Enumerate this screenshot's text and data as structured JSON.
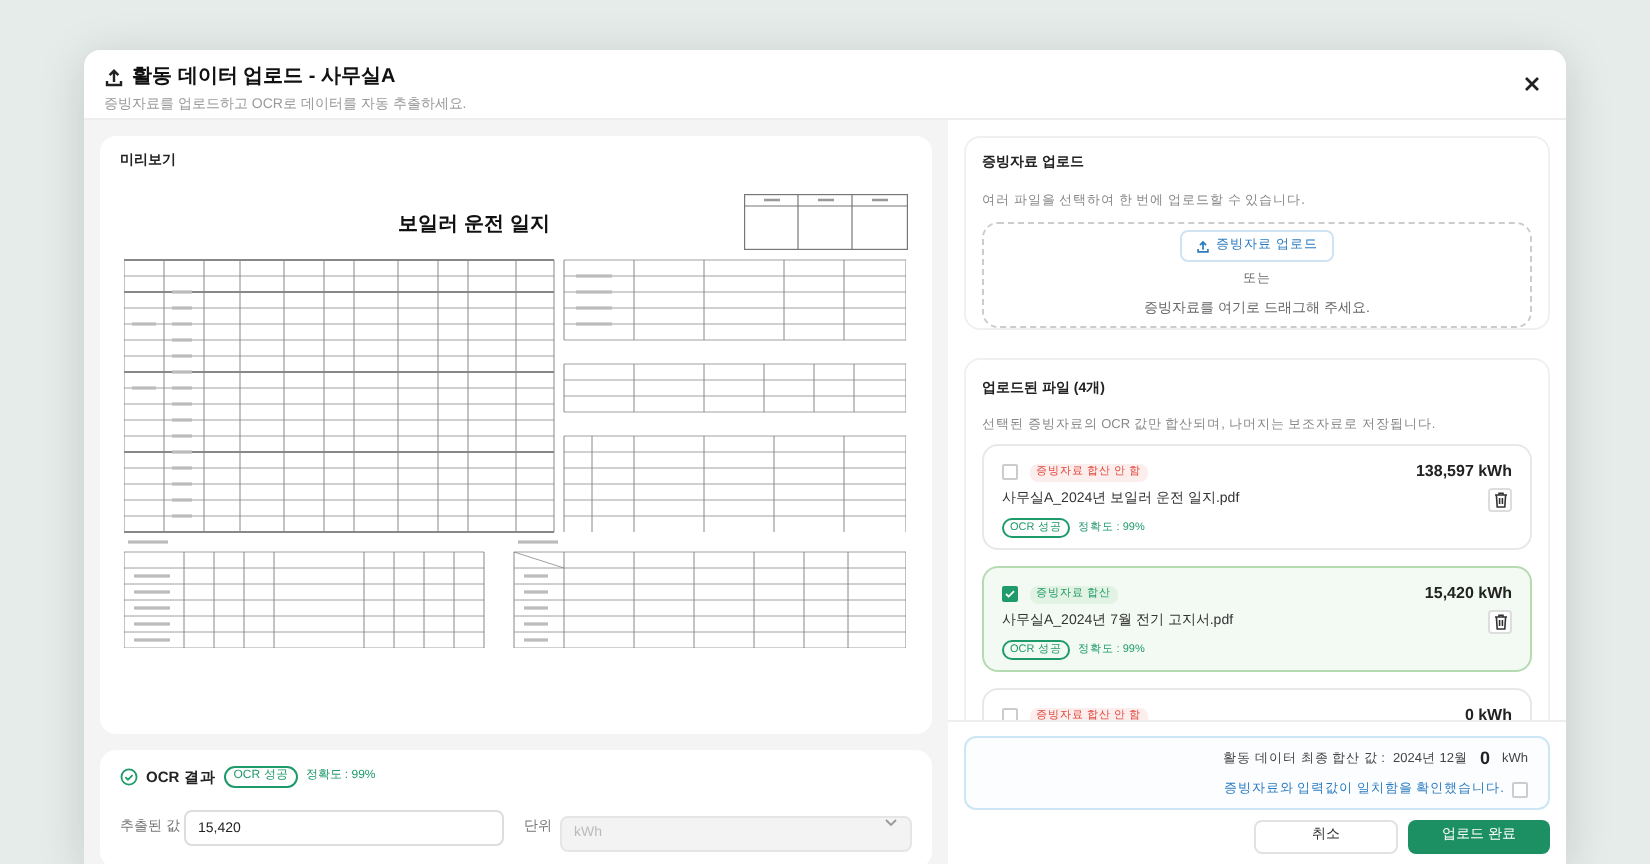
{
  "dialog": {
    "title": "활동 데이터 업로드 - 사무실A",
    "subtitle": "증빙자료를 업로드하고 OCR로 데이터를 자동 추출하세요."
  },
  "preview": {
    "title": "미리보기",
    "document": {
      "title": "보일러 운전 일지"
    }
  },
  "ocr_result": {
    "title": "OCR 결과",
    "status": "OCR 성공",
    "accuracy": "정확도 : 99%",
    "value_label": "추출된 값",
    "value": "15,420",
    "unit_label": "단위",
    "unit_placeholder": "kWh"
  },
  "upload": {
    "title": "증빙자료 업로드",
    "description": "여러 파일을 선택하여 한 번에 업로드할 수 있습니다.",
    "button": "증빙자료 업로드",
    "or": "또는",
    "drop_hint": "증빙자료를 여기로 드래그해 주세요."
  },
  "files": {
    "title": "업로드된 파일 (4개)",
    "description": "선택된 증빙자료의 OCR 값만 합산되며, 나머지는 보조자료로 저장됩니다.",
    "items": [
      {
        "checked": false,
        "badge": "증빙자료 합산 안 함",
        "value": "138,597 kWh",
        "filename": "사무실A_2024년 보일러 운전 일지.pdf",
        "ocr_status": "OCR 성공",
        "accuracy": "정확도 : 99%"
      },
      {
        "checked": true,
        "badge": "증빙자료 합산",
        "value": "15,420 kWh",
        "filename": "사무실A_2024년 7월 전기 고지서.pdf",
        "ocr_status": "OCR 성공",
        "accuracy": "정확도 : 99%"
      },
      {
        "checked": false,
        "badge": "증빙자료 합산 안 함",
        "value": "0 kWh"
      }
    ]
  },
  "summary": {
    "label": "활동 데이터 최종 합산 값 :",
    "period": "2024년 12월",
    "total": "0",
    "unit": "kWh",
    "confirm_text": "증빙자료와 입력값이 일치함을 확인했습니다.",
    "confirmed": false
  },
  "buttons": {
    "cancel": "취소",
    "submit": "업로드 완료"
  }
}
